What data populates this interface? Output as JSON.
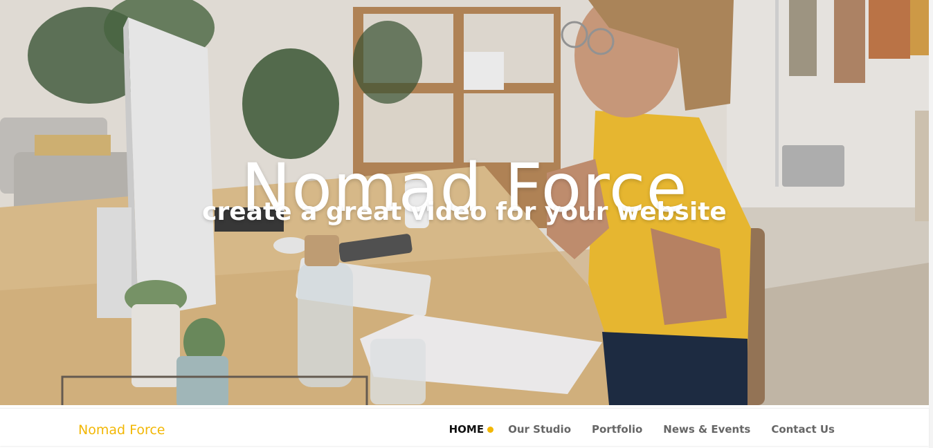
{
  "hero": {
    "title": "Nomad Force",
    "subtitle": "create a great video for your website"
  },
  "navbar": {
    "brand": "Nomad Force",
    "items": [
      {
        "label": "HOME",
        "active": true
      },
      {
        "label": "Our Studio",
        "active": false
      },
      {
        "label": "Portfolio",
        "active": false
      },
      {
        "label": "News & Events",
        "active": false
      },
      {
        "label": "Contact Us",
        "active": false
      }
    ]
  },
  "colors": {
    "accent": "#f2b705",
    "nav_text": "#666666",
    "nav_active": "#111111",
    "hero_text": "#ffffff"
  }
}
